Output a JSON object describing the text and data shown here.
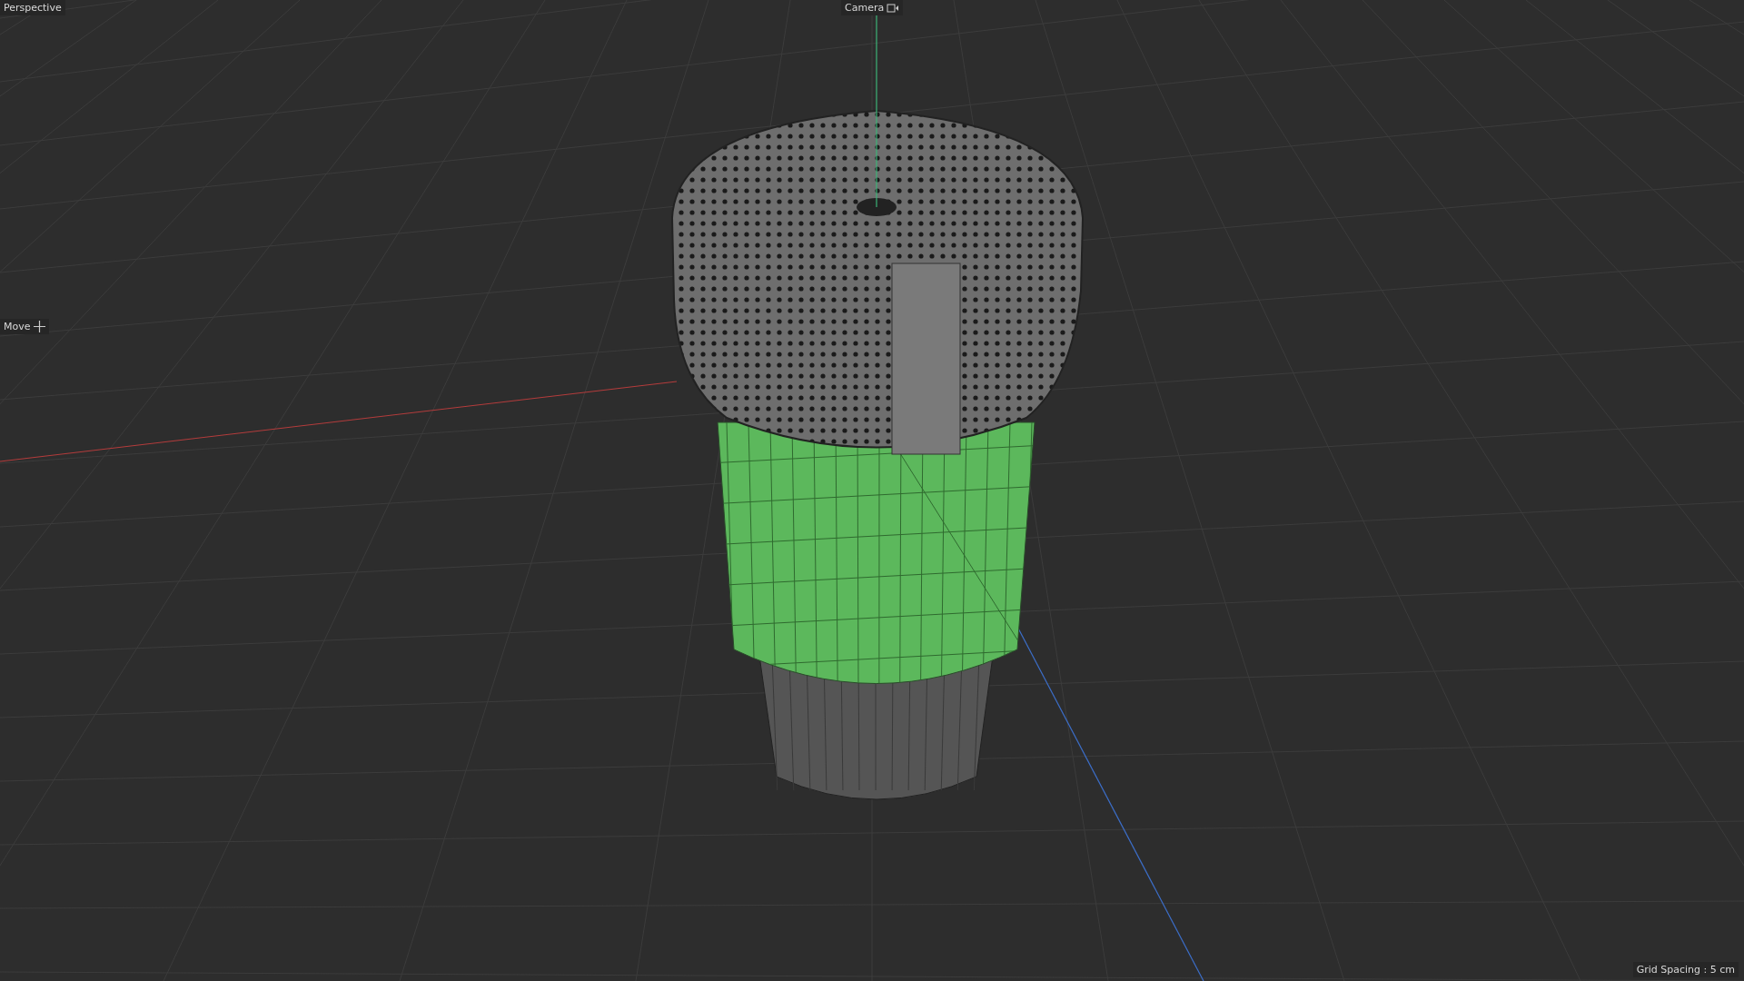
{
  "viewport": {
    "view_name": "Perspective",
    "camera": "Camera",
    "tool": "Move",
    "grid_spacing": "Grid Spacing : 5 cm"
  }
}
